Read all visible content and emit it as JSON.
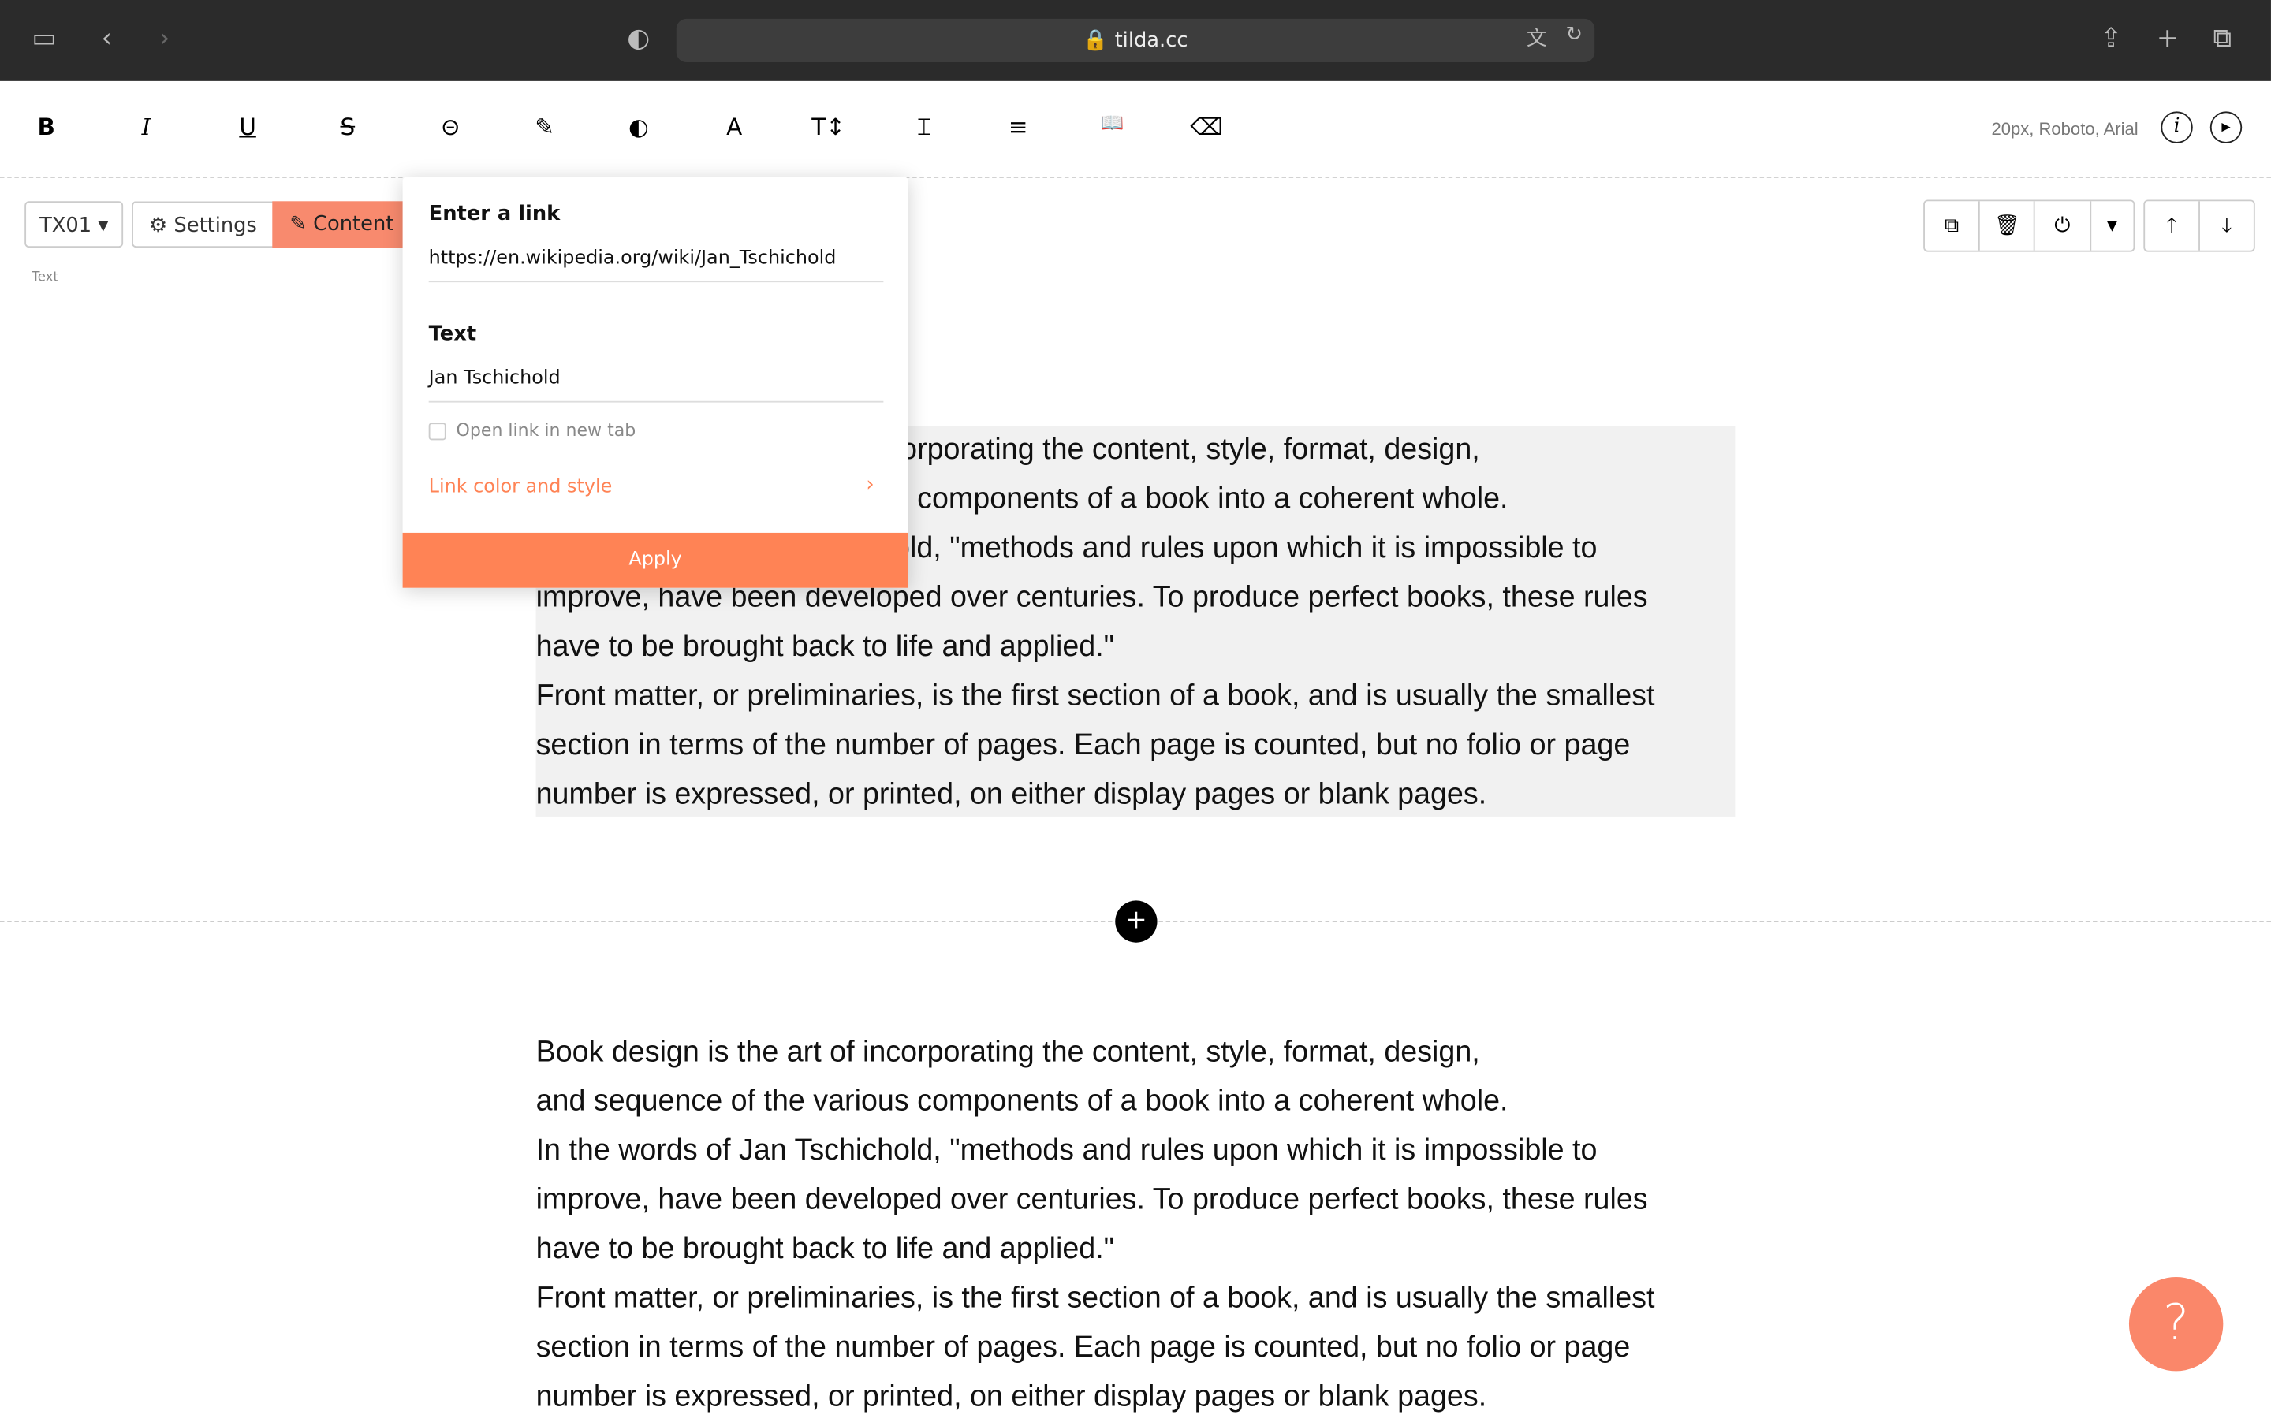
{
  "browser": {
    "url": "tilda.cc"
  },
  "toolbar": {
    "tools": [
      "B",
      "I",
      "U",
      "S",
      "⊝",
      "✎",
      "◐",
      "A",
      "T↕",
      "⌶",
      "≡",
      "📖",
      "⌫"
    ],
    "font_info": "20px, Roboto, Arial"
  },
  "block": {
    "code": "TX01",
    "settings": "Settings",
    "content": "Content",
    "type_label": "Text"
  },
  "link_popup": {
    "link_label": "Enter a link",
    "link_value": "https://en.wikipedia.org/wiki/Jan_Tschichold",
    "text_label": "Text",
    "text_value": "Jan Tschichold",
    "new_tab": "Open link in new tab",
    "new_tab_checked": false,
    "style_link": "Link color and style",
    "apply": "Apply"
  },
  "paragraphs": [
    "Book design is the art of incorporating the content, style, format, design,",
    "and sequence of the various components of a book into a coherent whole.",
    "In the words of Jan Tschichold, \"methods and rules upon which it is impossible to",
    "improve, have been developed over centuries. To produce perfect books, these rules",
    "have to be brought back to life and applied.\"",
    "Front matter, or preliminaries, is the first section of a book, and is usually the smallest",
    "section in terms of the number of pages. Each page is counted, but no folio or page",
    "number is expressed, or printed, on either display pages or blank pages."
  ],
  "help": "?",
  "colors": {
    "accent": "#ff8355",
    "content_btn": "#f88a6e"
  }
}
